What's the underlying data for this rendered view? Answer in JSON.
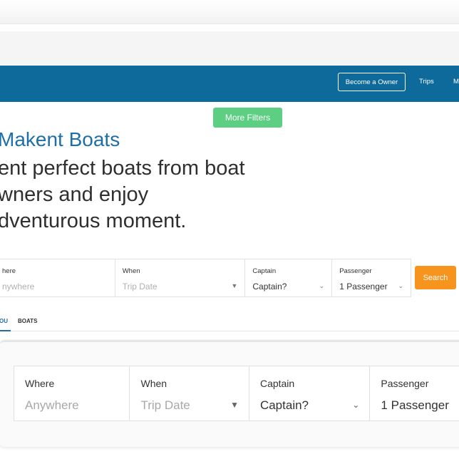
{
  "nav": {
    "become_owner": "Become a Owner",
    "trips": "Trips",
    "more": "M"
  },
  "filters_button": "More Filters",
  "brand": "Makent Boats",
  "headline": [
    "ent perfect boats from boat",
    "wners and enjoy",
    "dventurous moment."
  ],
  "search": {
    "where_label": "here",
    "where_placeholder": "nywhere",
    "when_label": "When",
    "when_placeholder": "Trip Date",
    "captain_label": "Captain",
    "captain_value": "Captain?",
    "passenger_label": "Passenger",
    "passenger_value": "1 Passenger",
    "button": "Search"
  },
  "tabs": [
    "OU",
    "BOATS"
  ],
  "zoom": {
    "where_label": "Where",
    "where_placeholder": "Anywhere",
    "when_label": "When",
    "when_placeholder": "Trip Date",
    "captain_label": "Captain",
    "captain_value": "Captain?",
    "passenger_label": "Passenger",
    "passenger_value": "1 Passenger"
  },
  "icons": {
    "caret": "chevron-down-icon",
    "triangle": "caret-down-icon"
  },
  "colors": {
    "navbar": "#0e6a9a",
    "brand": "#1e6fa8",
    "filters": "#5ccf82",
    "search_button": "#f7941d"
  }
}
